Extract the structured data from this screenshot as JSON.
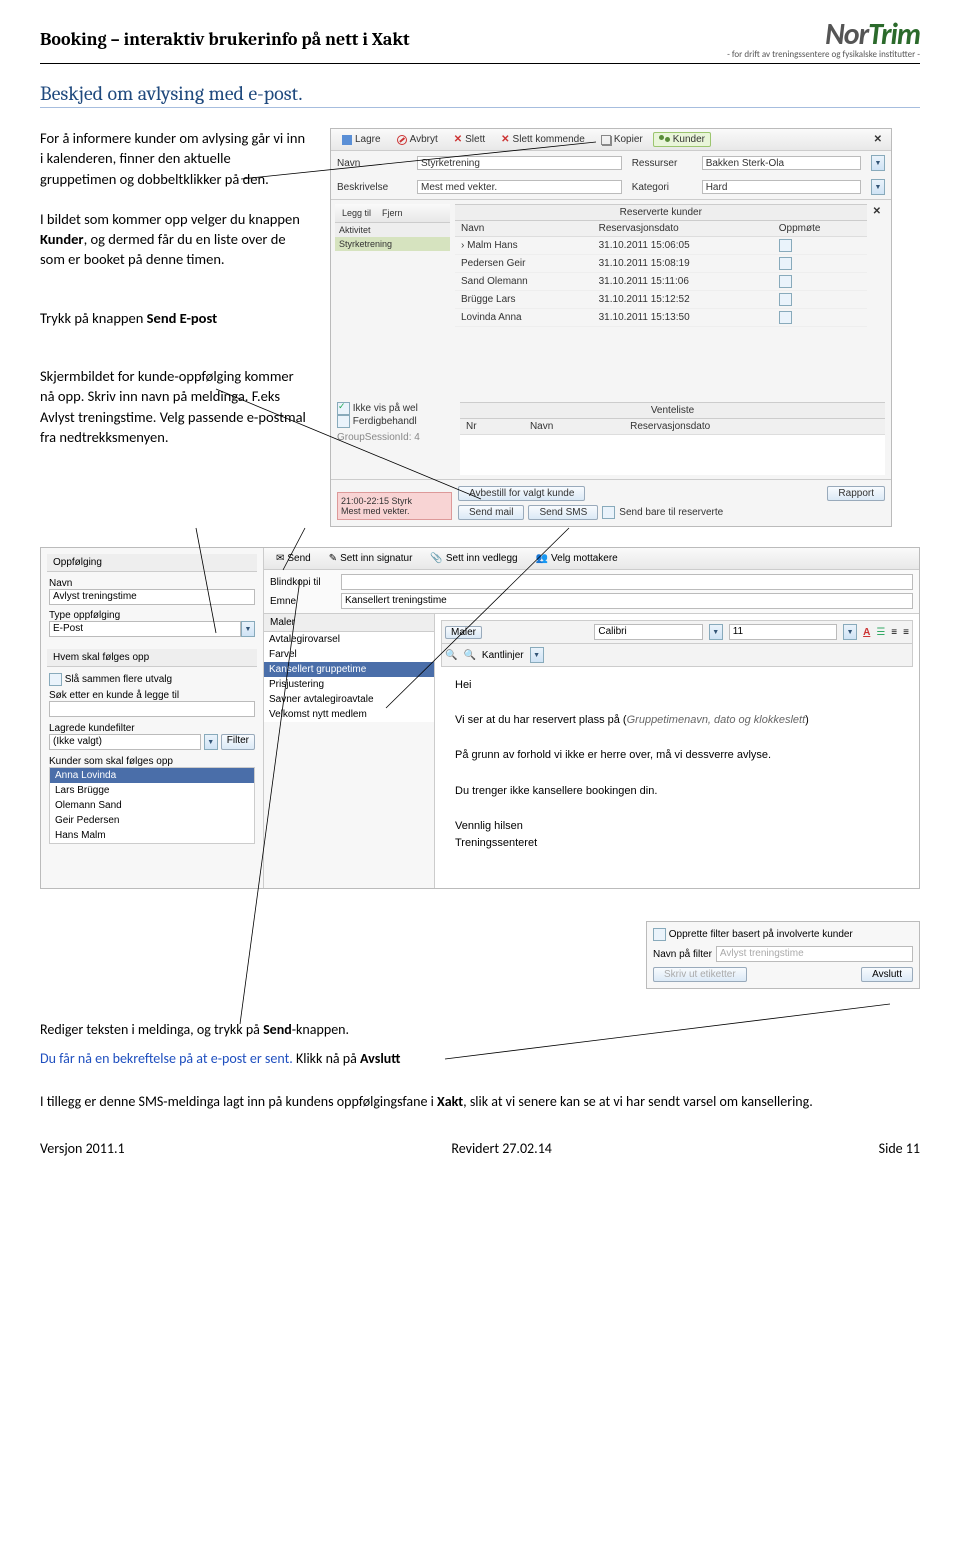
{
  "doc": {
    "header_title": "Booking – interaktiv brukerinfo på nett i Xakt",
    "logo_main": "NorTrim",
    "logo_sub": "- for drift av treningssentere og fysikalske institutter -",
    "section_heading": "Beskjed om avlysing  med e-post.",
    "para1": "For å informere kunder om avlysing går vi inn i kalenderen, finner den aktuelle gruppetimen og dobbeltklikker på den.",
    "para2a": "I bildet som kommer opp velger du knappen ",
    "para2b": "Kunder",
    "para2c": ", og dermed får du en liste over de som er booket på denne timen.",
    "para3a": "Trykk på knappen ",
    "para3b": "Send E-post",
    "para4": "Skjermbildet for kunde-oppfølging kommer nå opp. Skriv inn navn på meldinga. F.eks Avlyst treningstime.  Velg passende e-postmal fra nedtrekksmenyen.",
    "para5a": "Rediger teksten i meldinga, og trykk på ",
    "para5b": "Send",
    "para5c": "-knappen.",
    "para6a": "Du får nå en bekreftelse på at e-post er sent.",
    "para6b": " Klikk nå på ",
    "para6c": "Avslutt",
    "para7a": "I tillegg er denne SMS-meldinga lagt inn på kundens oppfølgingsfane i ",
    "para7b": "Xakt",
    "para7c": ", slik at vi senere kan se at vi har sendt varsel om kansellering.",
    "footer_left": "Versjon 2011.1",
    "footer_mid": "Revidert 27.02.14",
    "footer_right": "Side 11"
  },
  "shot1": {
    "tb": {
      "lagre": "Lagre",
      "avbryt": "Avbryt",
      "slett": "Slett",
      "slett_kommende": "Slett kommende",
      "kopier": "Kopier",
      "kunder": "Kunder"
    },
    "labels": {
      "navn": "Navn",
      "beskrivelse": "Beskrivelse",
      "ressurser": "Ressurser",
      "kategori": "Kategori"
    },
    "values": {
      "navn": "Styrketrening",
      "beskrivelse": "Mest med vekter.",
      "ressurs": "Bakken Sterk-Ola",
      "kategori": "Hard"
    },
    "sidebar": {
      "legg_til": "Legg til",
      "fjern": "Fjern",
      "aktivitet": "Aktivitet",
      "item": "Styrketrening"
    },
    "panel_reserved": "Reserverte kunder",
    "cols": {
      "navn": "Navn",
      "dato": "Reservasjonsdato",
      "oppmote": "Oppmøte"
    },
    "rows": [
      {
        "n": "Malm Hans",
        "d": "31.10.2011 15:06:05"
      },
      {
        "n": "Pedersen Geir",
        "d": "31.10.2011 15:08:19"
      },
      {
        "n": "Sand Olemann",
        "d": "31.10.2011 15:11:06"
      },
      {
        "n": "Brügge Lars",
        "d": "31.10.2011 15:12:52"
      },
      {
        "n": "Lovinda Anna",
        "d": "31.10.2011 15:13:50"
      }
    ],
    "chk1": "Ikke vis på wel",
    "chk2": "Ferdigbehandl",
    "gsid": "GroupSessionId: 4",
    "panel_vent": "Venteliste",
    "vent_cols": {
      "nr": "Nr",
      "navn": "Navn",
      "dato": "Reservasjonsdato"
    },
    "cal": {
      "time": "21:00-22:15 Styrk",
      "desc": "Mest med vekter."
    },
    "bottom": {
      "avbestill": "Avbestill for valgt kunde",
      "rapport": "Rapport",
      "send_mail": "Send mail",
      "send_sms": "Send SMS",
      "chk": "Send bare til reserverte"
    }
  },
  "shot2": {
    "left": {
      "title": "Oppfølging",
      "navn_label": "Navn",
      "navn_val": "Avlyst treningstime",
      "type_label": "Type oppfølging",
      "type_val": "E-Post",
      "hvem": "Hvem skal følges opp",
      "chk_merge": "Slå sammen flere utvalg",
      "sok": "Søk etter en kunde å legge til",
      "lagrede": "Lagrede kundefilter",
      "ikke_valgt": "(Ikke valgt)",
      "filter": "Filter",
      "kunder_label": "Kunder som skal følges opp",
      "kunder": [
        "Anna  Lovinda",
        "Lars Brügge",
        "Olemann Sand",
        "Geir Pedersen",
        "Hans Malm"
      ]
    },
    "topbar": {
      "send": "Send",
      "signatur": "Sett inn signatur",
      "vedlegg": "Sett inn vedlegg",
      "mottakere": "Velg mottakere"
    },
    "fields": {
      "bcc": "Blindkopi til",
      "emne_label": "Emne",
      "emne_val": "Kansellert treningstime"
    },
    "maler": {
      "title": "Maler",
      "items": [
        "Avtalegirovarsel",
        "Farvel",
        "Kansellert gruppetime",
        "Prisjustering",
        "Savner avtalegiroavtale",
        "Velkomst nytt medlem"
      ]
    },
    "editor": {
      "maler": "Maler",
      "font": "Calibri",
      "size": "11",
      "kantlinjer": "Kantlinjer"
    },
    "body": {
      "hei": "Hei",
      "l1a": "Vi ser at du har reservert plass på  (",
      "l1b": "Gruppetimenavn, dato og klokkeslett",
      "l1c": ")",
      "l2": "På grunn av forhold vi ikke er herre over, må vi dessverre avlyse.",
      "l3": "Du trenger ikke kansellere bookingen din.",
      "l4": "Vennlig hilsen",
      "l5": "Treningssenteret"
    }
  },
  "dialog": {
    "chk": "Opprette filter basert på involverte kunder",
    "navn_label": "Navn på filter",
    "navn_val": "Avlyst treningstime",
    "skriv": "Skriv ut etiketter",
    "avslutt": "Avslutt"
  }
}
